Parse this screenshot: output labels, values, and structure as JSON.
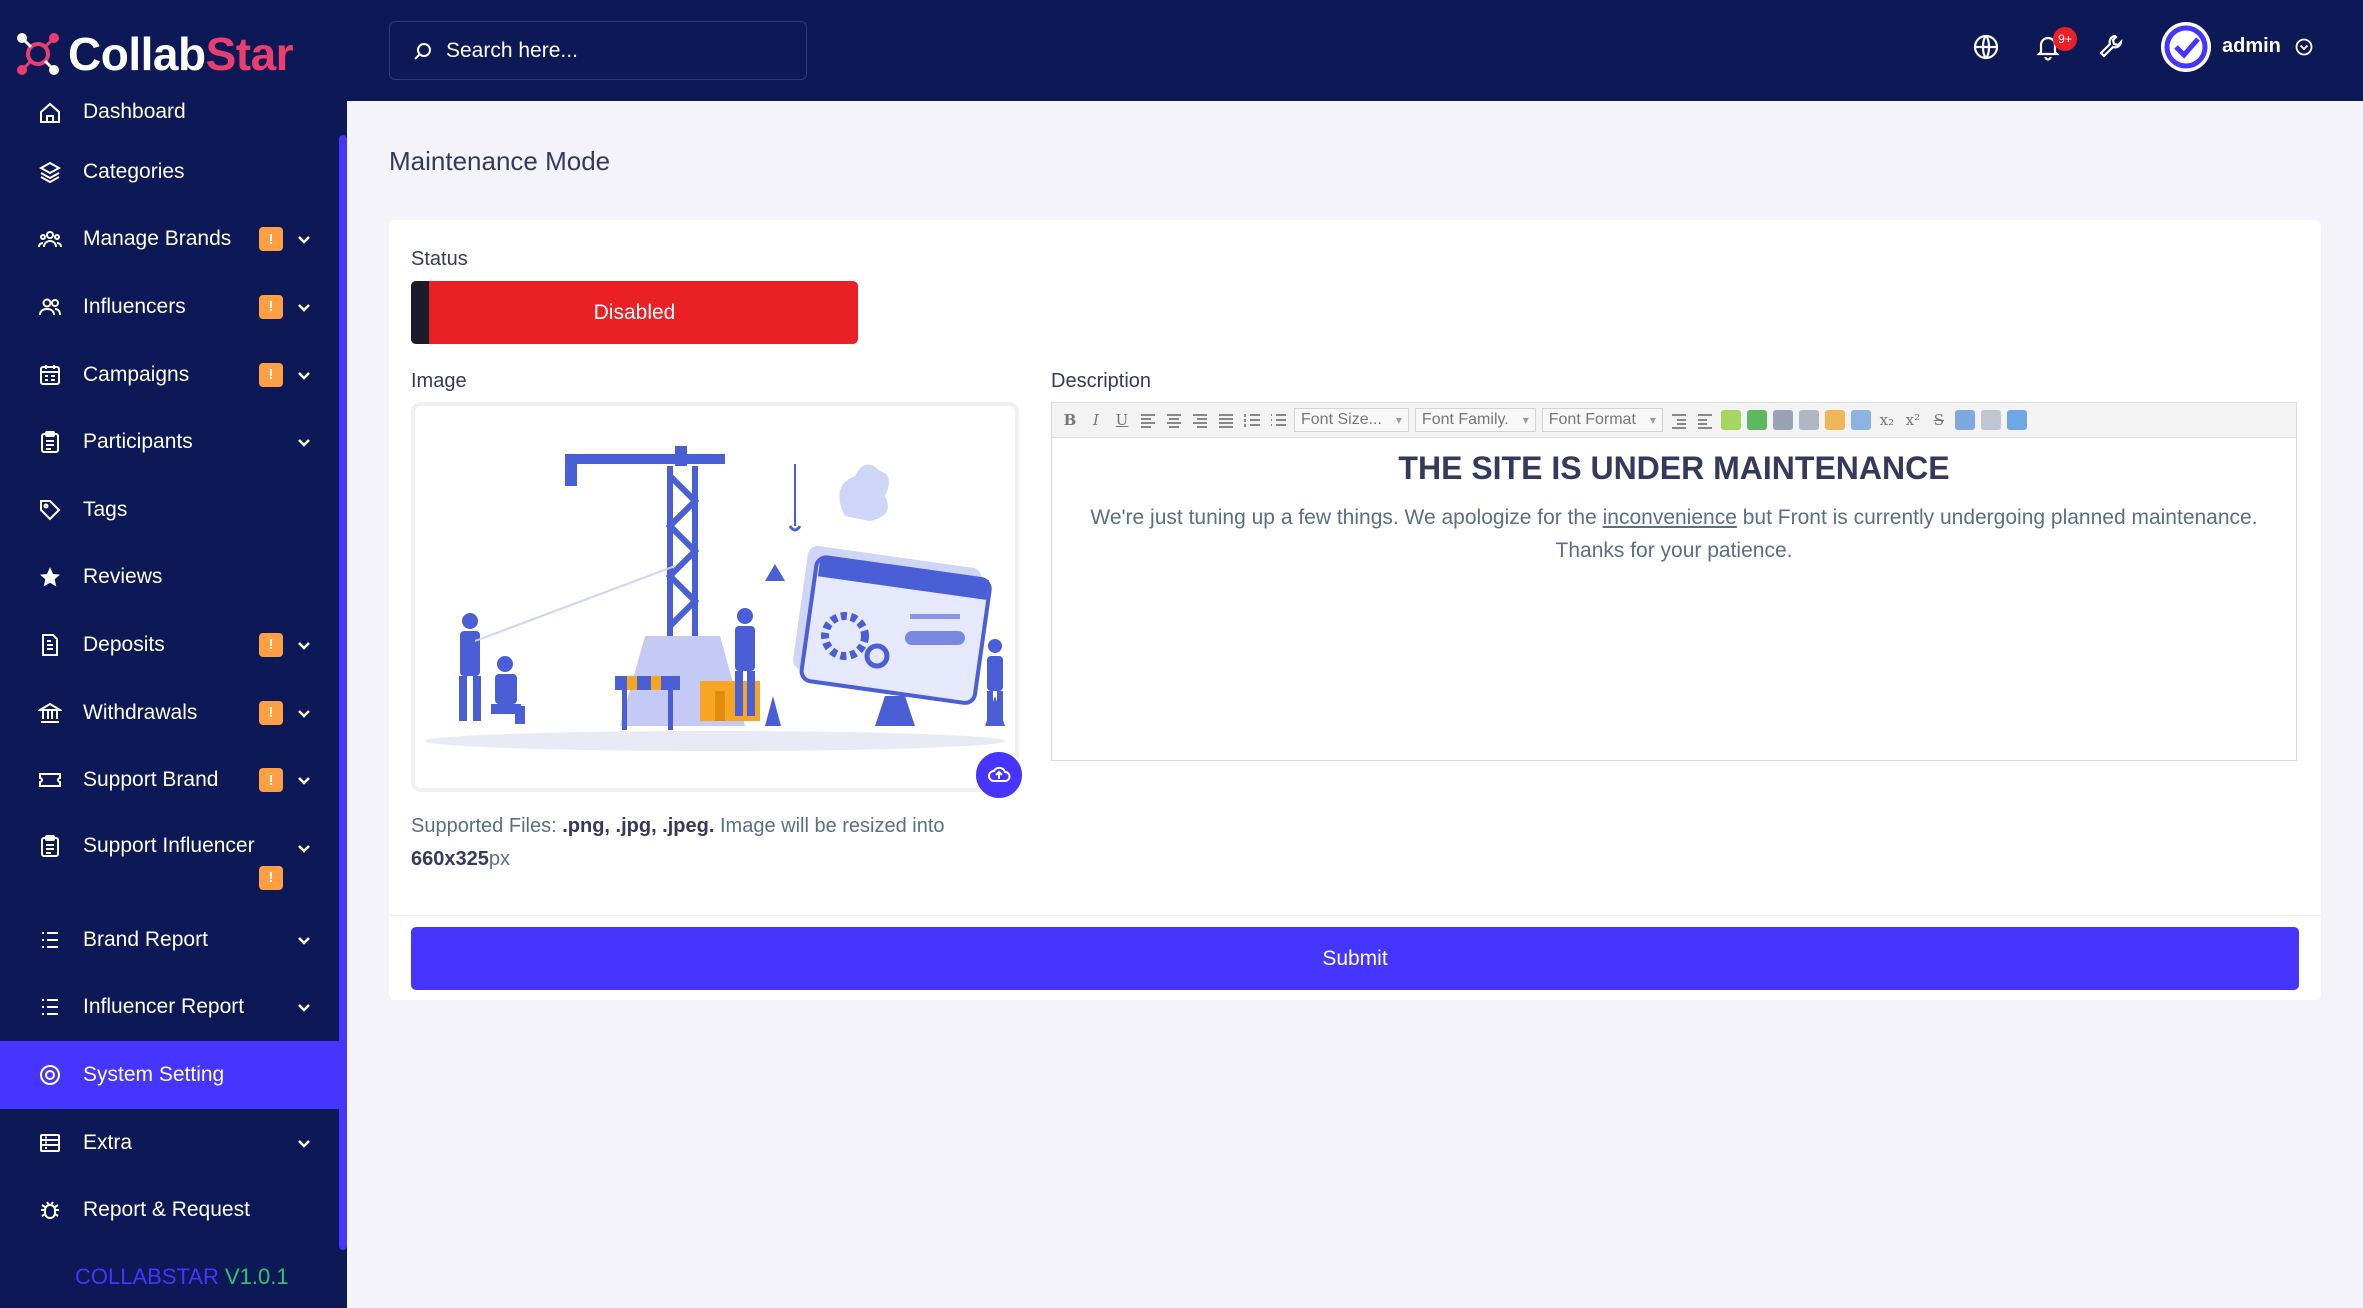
{
  "app": {
    "logo_part1": "Collab",
    "logo_part2": "Star",
    "version_prefix": "COLLABSTAR",
    "version_number": "V1.0.1"
  },
  "colors": {
    "sidebar_bg": "#0d1856",
    "accent": "#4634ff",
    "danger": "#ea2027",
    "warning_badge": "#ff9f43",
    "logo_red": "#ea3e6e"
  },
  "sidebar": {
    "items": [
      {
        "label": "Dashboard",
        "icon": "home-icon",
        "badge": "",
        "has_chevron": false
      },
      {
        "label": "Categories",
        "icon": "layers-icon",
        "badge": "",
        "has_chevron": false
      },
      {
        "label": "Manage Brands",
        "icon": "users-group-icon",
        "badge": "!",
        "has_chevron": true
      },
      {
        "label": "Influencers",
        "icon": "users-icon",
        "badge": "!",
        "has_chevron": true
      },
      {
        "label": "Campaigns",
        "icon": "calendar-icon",
        "badge": "!",
        "has_chevron": true
      },
      {
        "label": "Participants",
        "icon": "clipboard-icon",
        "badge": "",
        "has_chevron": true
      },
      {
        "label": "Tags",
        "icon": "tag-icon",
        "badge": "",
        "has_chevron": false
      },
      {
        "label": "Reviews",
        "icon": "star-icon",
        "badge": "",
        "has_chevron": false
      },
      {
        "label": "Deposits",
        "icon": "file-invoice-icon",
        "badge": "!",
        "has_chevron": true
      },
      {
        "label": "Withdrawals",
        "icon": "bank-icon",
        "badge": "!",
        "has_chevron": true
      },
      {
        "label": "Support Brand",
        "icon": "ticket-icon",
        "badge": "!",
        "has_chevron": true
      },
      {
        "label": "Support Influencer",
        "icon": "clipboard-list-icon",
        "badge": "!",
        "has_chevron": true
      },
      {
        "label": "Brand Report",
        "icon": "list-icon",
        "badge": "",
        "has_chevron": true
      },
      {
        "label": "Influencer Report",
        "icon": "list-icon",
        "badge": "",
        "has_chevron": true
      },
      {
        "label": "System Setting",
        "icon": "settings-icon",
        "badge": "",
        "has_chevron": false,
        "active": true
      },
      {
        "label": "Extra",
        "icon": "server-icon",
        "badge": "",
        "has_chevron": true
      },
      {
        "label": "Report & Request",
        "icon": "bug-icon",
        "badge": "",
        "has_chevron": false
      }
    ]
  },
  "topbar": {
    "search_placeholder": "Search here...",
    "notification_count": "9+",
    "user_name": "admin"
  },
  "page": {
    "title": "Maintenance Mode",
    "status_label": "Status",
    "status_value": "Disabled",
    "image_label": "Image",
    "image_help_prefix": "Supported Files:",
    "image_help_types": ".png, .jpg, .jpeg.",
    "image_help_mid": "Image will be resized into",
    "image_help_size": "660x325",
    "image_help_unit": "px",
    "description_label": "Description",
    "editor": {
      "font_size_select": "Font Size...",
      "font_family_select": "Font Family.",
      "font_format_select": "Font Format",
      "heading": "THE SITE IS UNDER MAINTENANCE",
      "body_before": "We're just tuning up a few things. We apologize for the",
      "body_link": "inconvenience",
      "body_after": "but Front is currently undergoing planned maintenance. Thanks for your patience."
    },
    "submit_label": "Submit"
  }
}
